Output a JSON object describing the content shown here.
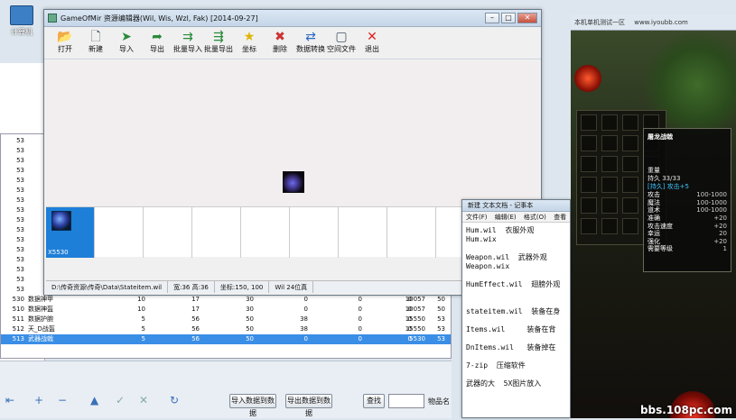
{
  "desktop": {
    "icon_label": "计算机"
  },
  "editor": {
    "title": "GameOfMir 资源编辑器(Wil, Wis, Wzl, Fak) [2014-09-27]",
    "tools": [
      {
        "icon": "folder-icon",
        "label": "打开"
      },
      {
        "icon": "new-file-icon",
        "label": "新建"
      },
      {
        "icon": "import-icon",
        "label": "导入"
      },
      {
        "icon": "export-icon",
        "label": "导出"
      },
      {
        "icon": "batch-import-icon",
        "label": "批量导入"
      },
      {
        "icon": "batch-export-icon",
        "label": "批量导出"
      },
      {
        "icon": "star-icon",
        "label": "坐标"
      },
      {
        "icon": "delete-icon",
        "label": "删除"
      },
      {
        "icon": "convert-icon",
        "label": "数据转换"
      },
      {
        "icon": "blank-file-icon",
        "label": "空间文件"
      },
      {
        "icon": "close-icon",
        "label": "退出"
      }
    ],
    "thumb_selected_label": "X5530",
    "status": [
      "D:\\传奇资源\\传奇\\Data\\Stateitem.wil",
      "宽:36 高:36",
      "坐标:150, 100",
      "Wil 24位真"
    ]
  },
  "db_grid": {
    "rows": [
      [
        "53",
        "",
        "",
        "",
        "",
        "",
        "",
        "",
        "",
        ""
      ],
      [
        "53",
        "",
        "",
        "",
        "",
        "",
        "",
        "",
        "",
        ""
      ],
      [
        "53",
        "",
        "",
        "",
        "",
        "",
        "",
        "",
        "",
        ""
      ],
      [
        "53",
        "",
        "",
        "",
        "",
        "",
        "",
        "",
        "",
        ""
      ],
      [
        "53",
        "",
        "",
        "",
        "",
        "",
        "",
        "",
        "",
        ""
      ],
      [
        "53",
        "",
        "",
        "",
        "",
        "",
        "",
        "",
        "",
        ""
      ],
      [
        "53",
        "",
        "",
        "",
        "",
        "",
        "",
        "",
        "",
        ""
      ],
      [
        "53",
        "",
        "",
        "",
        "",
        "",
        "",
        "",
        "",
        ""
      ],
      [
        "53",
        "",
        "",
        "",
        "",
        "",
        "",
        "",
        "",
        ""
      ],
      [
        "53",
        "",
        "",
        "",
        "",
        "",
        "",
        "",
        "",
        ""
      ],
      [
        "53",
        "",
        "",
        "",
        "",
        "",
        "",
        "",
        "",
        ""
      ],
      [
        "53",
        "",
        "",
        "",
        "",
        "",
        "",
        "",
        "",
        ""
      ],
      [
        "53",
        "",
        "",
        "",
        "",
        "",
        "",
        "",
        "",
        ""
      ],
      [
        "53",
        "",
        "",
        "",
        "",
        "",
        "",
        "",
        "",
        ""
      ],
      [
        "53",
        "",
        "",
        "",
        "",
        "",
        "",
        "",
        "",
        ""
      ],
      [
        "53",
        "",
        "",
        "",
        "",
        "",
        "",
        "",
        "",
        ""
      ],
      [
        "530",
        "数据神甲",
        "10",
        "17",
        "30",
        "0",
        "0",
        "0",
        "10057",
        "50"
      ],
      [
        "510",
        "数据神盔",
        "10",
        "17",
        "30",
        "0",
        "0",
        "0",
        "10057",
        "50"
      ],
      [
        "511",
        "数据护腕",
        "5",
        "56",
        "50",
        "38",
        "0",
        "0",
        "15550",
        "53"
      ],
      [
        "512",
        "天_D战盔",
        "5",
        "56",
        "50",
        "38",
        "0",
        "0",
        "15550",
        "53"
      ],
      [
        "513",
        "武器战戟",
        "5",
        "56",
        "50",
        "0",
        "0",
        "0",
        "5530",
        "53"
      ]
    ],
    "selected_row_index": 20
  },
  "db_bottom": {
    "import_button": "导入数据到数据",
    "export_button": "导出数据到数据",
    "find_label": "查找",
    "field_label": "物品名"
  },
  "game": {
    "tabs": [
      "本机单机测试一区",
      "www.iyoubb.com"
    ],
    "tooltip_title": "屠龙战戟",
    "tooltip_sub": [
      "重量",
      "持久 33/33"
    ],
    "tooltip_blue": "[持久] 攻击+5",
    "stats": [
      {
        "k": "攻击",
        "v": "100-1000"
      },
      {
        "k": "魔法",
        "v": "100-1000"
      },
      {
        "k": "道术",
        "v": "100-1000"
      },
      {
        "k": "准确",
        "v": "+20"
      },
      {
        "k": "攻击速度",
        "v": "+20"
      },
      {
        "k": "幸运",
        "v": "20"
      },
      {
        "k": "强化",
        "v": "+20"
      },
      {
        "k": "需要等级",
        "v": "1"
      }
    ],
    "watermark": "bbs.108pc.com"
  },
  "notepad": {
    "title": "新建 文本文档 - 记事本",
    "menu": [
      "文件(F)",
      "编辑(E)",
      "格式(O)",
      "查看"
    ],
    "lines": [
      "Hum.wil  衣服外观",
      "Hum.wix",
      "",
      "Weapon.wil  武器外观",
      "Weapon.wix",
      "",
      "HumEffect.wil  翅膀外观",
      "",
      "",
      "stateitem.wil  装备在身",
      "",
      "Items.wil     装备在背",
      "",
      "DnItems.wil   装备掉在",
      "",
      "7-zip  压缩软件",
      "",
      "武器的大  5X图片放入"
    ]
  }
}
